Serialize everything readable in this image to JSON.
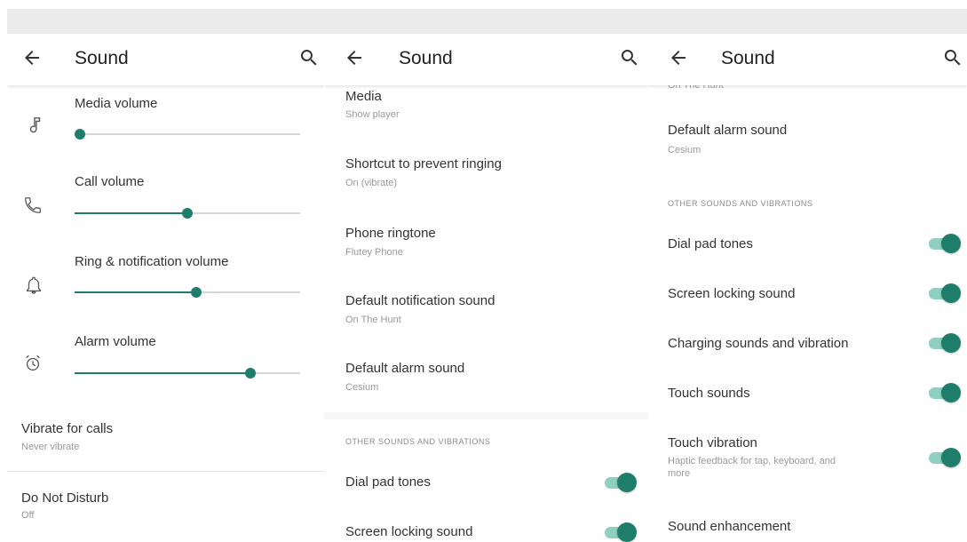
{
  "panels": [
    {
      "title": "Sound",
      "volumes": [
        {
          "label": "Media volume",
          "icon": "music-note-icon",
          "level": 0.0
        },
        {
          "label": "Call volume",
          "icon": "phone-icon",
          "level": 0.5
        },
        {
          "label": "Ring & notification volume",
          "icon": "bell-icon",
          "level": 0.54
        },
        {
          "label": "Alarm volume",
          "icon": "alarm-clock-icon",
          "level": 0.78
        }
      ],
      "items": [
        {
          "title": "Vibrate for calls",
          "summary": "Never vibrate"
        },
        {
          "title": "Do Not Disturb",
          "summary": "Off"
        }
      ]
    },
    {
      "title": "Sound",
      "items": [
        {
          "title": "Media",
          "summary": "Show player"
        },
        {
          "title": "Shortcut to prevent ringing",
          "summary": "On (vibrate)"
        },
        {
          "title": "Phone ringtone",
          "summary": "Flutey Phone"
        },
        {
          "title": "Default notification sound",
          "summary": "On The Hunt"
        },
        {
          "title": "Default alarm sound",
          "summary": "Cesium"
        }
      ],
      "section_header": "OTHER SOUNDS AND VIBRATIONS",
      "toggles": [
        {
          "title": "Dial pad tones",
          "on": true
        },
        {
          "title": "Screen locking sound",
          "on": true
        }
      ]
    },
    {
      "title": "Sound",
      "partial_summary": "On The Hunt",
      "items": [
        {
          "title": "Default alarm sound",
          "summary": "Cesium"
        }
      ],
      "section_header": "OTHER SOUNDS AND VIBRATIONS",
      "toggles": [
        {
          "title": "Dial pad tones",
          "on": true
        },
        {
          "title": "Screen locking sound",
          "on": true
        },
        {
          "title": "Charging sounds and vibration",
          "on": true
        },
        {
          "title": "Touch sounds",
          "on": true
        },
        {
          "title": "Touch vibration",
          "summary_line1": "Haptic feedback for tap, keyboard, and",
          "summary_line2": "more",
          "on": true
        }
      ],
      "last_item": {
        "title": "Sound enhancement"
      }
    }
  ],
  "colors": {
    "accent": "#1e7d6b",
    "toggle_track": "#8fcfc0",
    "slider_track": "#d6d6d6"
  }
}
